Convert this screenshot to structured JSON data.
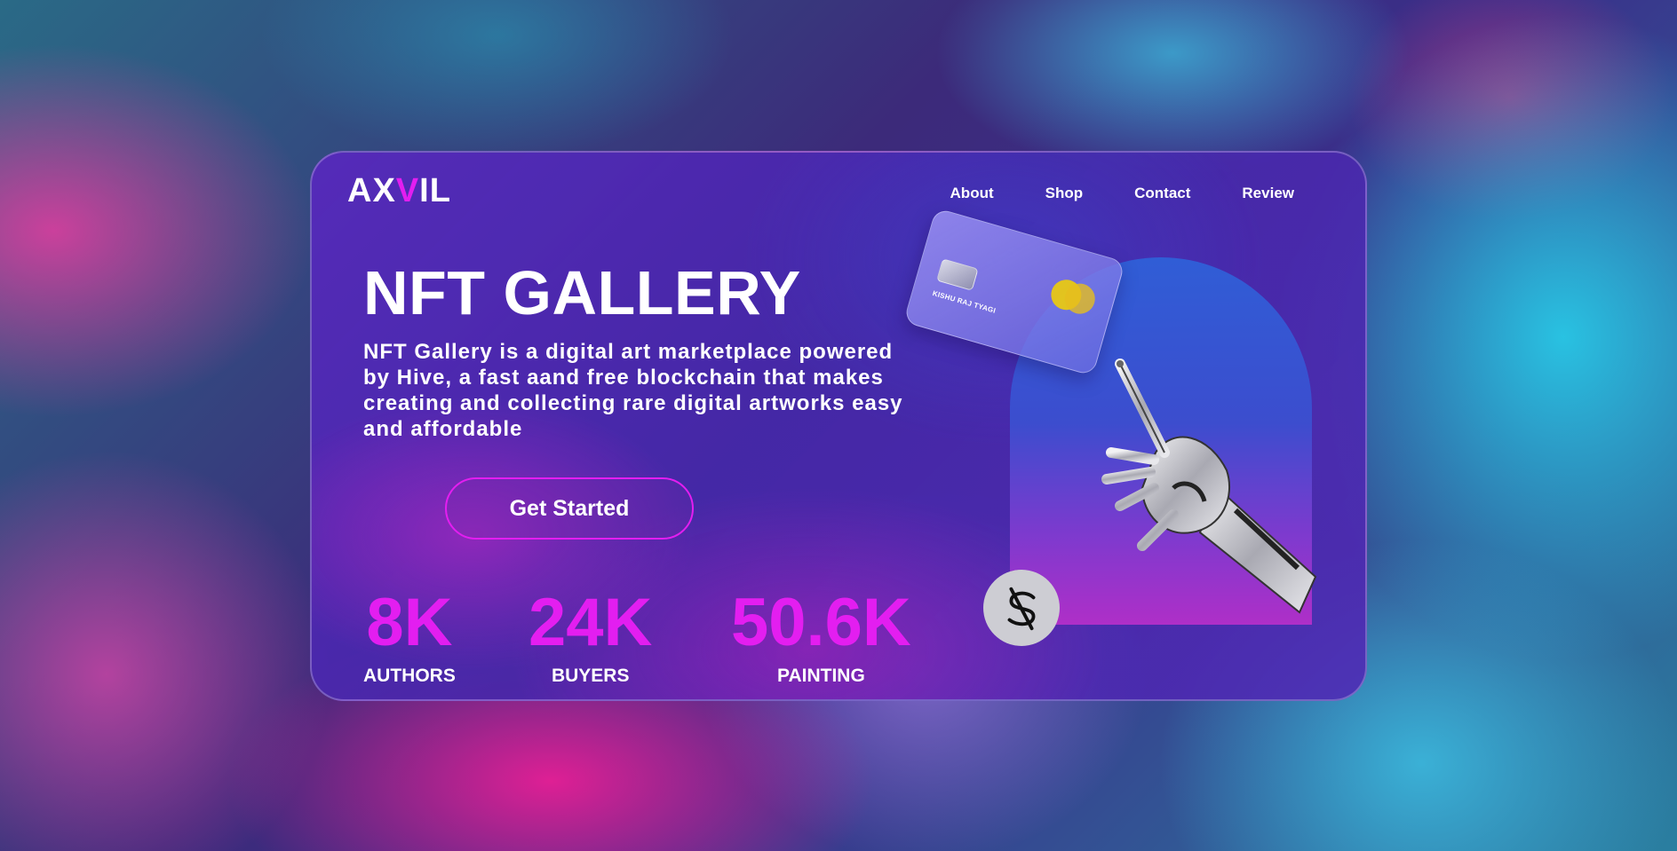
{
  "brand": {
    "logo_prefix": "AX",
    "logo_accent": "V",
    "logo_suffix": "IL",
    "accent_color": "#e31ef0"
  },
  "nav": {
    "items": [
      "About",
      "Shop",
      "Contact",
      "Review"
    ]
  },
  "hero": {
    "title": "NFT GALLERY",
    "description": "NFT Gallery is a digital art marketplace powered by Hive, a fast aand free blockchain that makes creating and collecting rare digital artworks easy and affordable",
    "cta_label": "Get Started"
  },
  "stats": [
    {
      "value": "8K",
      "label": "AUTHORS"
    },
    {
      "value": "24K",
      "label": "BUYERS"
    },
    {
      "value": "50.6K",
      "label": "PAINTING"
    }
  ],
  "card": {
    "holder_name": "KISHU RAJ TYAGI"
  },
  "icons": {
    "badge": "dollar-icon",
    "illustration": "robot-hand-icon",
    "card": "credit-card-icon"
  }
}
